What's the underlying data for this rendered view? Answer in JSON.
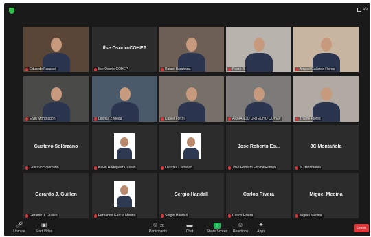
{
  "top": {
    "view_label": "Ve"
  },
  "participants": [
    {
      "label": "Eduardo Facussé",
      "name": "",
      "video": true
    },
    {
      "label": "Ilse Osorio-COHEP",
      "name": "Ilse Osorio-COHEP",
      "video": false
    },
    {
      "label": "Rafael Barahona",
      "name": "",
      "video": true,
      "active": true
    },
    {
      "label": "Pedro B.",
      "name": "",
      "video": true
    },
    {
      "label": "Anabel Gallardo Flores",
      "name": "",
      "video": true
    },
    {
      "label": "Elvin Mondragon",
      "name": "",
      "video": true
    },
    {
      "label": "Leonila Zepeda",
      "name": "",
      "video": true
    },
    {
      "label": "Daniel Fortín",
      "name": "",
      "video": true
    },
    {
      "label": "ARMANDO URTECHO COHEP",
      "name": "",
      "video": true
    },
    {
      "label": "Thiane Flores",
      "name": "",
      "video": true
    },
    {
      "label": "Gustavo Solórzano",
      "name": "Gustavo Solórzano",
      "video": false
    },
    {
      "label": "Kevin Rodriguez Castillo",
      "name": "",
      "video": false,
      "avatar": true
    },
    {
      "label": "Lourdes Carrasco",
      "name": "",
      "video": false,
      "avatar": true
    },
    {
      "label": "Jose Roberto EspinalRamos",
      "name": "Jose Roberto Es...",
      "video": false
    },
    {
      "label": "JC Montañola",
      "name": "JC Montañola",
      "video": false
    },
    {
      "label": "Gerardo J. Guillen",
      "name": "Gerardo J. Guillen",
      "video": false
    },
    {
      "label": "Fernando García Merino",
      "name": "",
      "video": false,
      "avatar": true
    },
    {
      "label": "Sergio Handall",
      "name": "Sergio Handall",
      "video": false
    },
    {
      "label": "Carlos Rivera",
      "name": "Carlos Rivera",
      "video": false
    },
    {
      "label": "Miguel Medina",
      "name": "Miguel Medina",
      "video": false
    }
  ],
  "toolbar": {
    "unmute": "Unmute",
    "start_video": "Start Video",
    "participants": "Participants",
    "participant_count": "20",
    "chat": "Chat",
    "share_screen": "Share Screen",
    "reactions": "Reactions",
    "apps": "Apps",
    "leave": "Leave"
  }
}
